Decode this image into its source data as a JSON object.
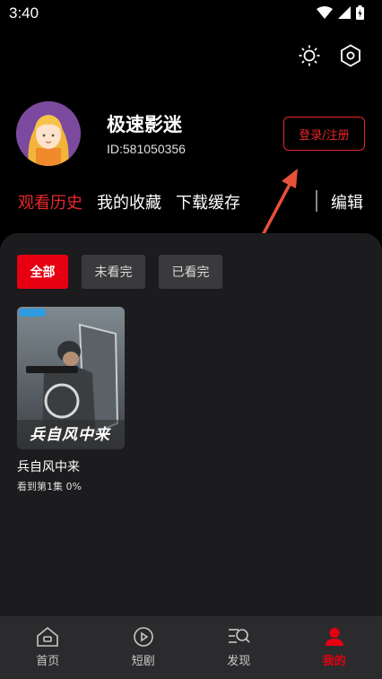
{
  "status_bar": {
    "time": "3:40"
  },
  "profile": {
    "username": "极速影迷",
    "user_id": "ID:581050356",
    "login_label": "登录/注册"
  },
  "tabs": [
    {
      "label": "观看历史",
      "active": true
    },
    {
      "label": "我的收藏",
      "active": false
    },
    {
      "label": "下载缓存",
      "active": false
    }
  ],
  "edit_label": "编辑",
  "filters": [
    {
      "label": "全部",
      "active": true
    },
    {
      "label": "未看完",
      "active": false
    },
    {
      "label": "已看完",
      "active": false
    }
  ],
  "history": [
    {
      "title": "兵自风中来",
      "progress": "看到第1集 0%",
      "poster_text": "兵自风中来"
    }
  ],
  "bottom_nav": [
    {
      "label": "首页",
      "icon": "home-icon",
      "active": false
    },
    {
      "label": "短剧",
      "icon": "play-circle-icon",
      "active": false
    },
    {
      "label": "发现",
      "icon": "discover-icon",
      "active": false
    },
    {
      "label": "我的",
      "icon": "person-icon",
      "active": true
    }
  ],
  "colors": {
    "accent": "#e60012",
    "panel": "#1c1c1e",
    "nav": "#2b2b2d"
  }
}
